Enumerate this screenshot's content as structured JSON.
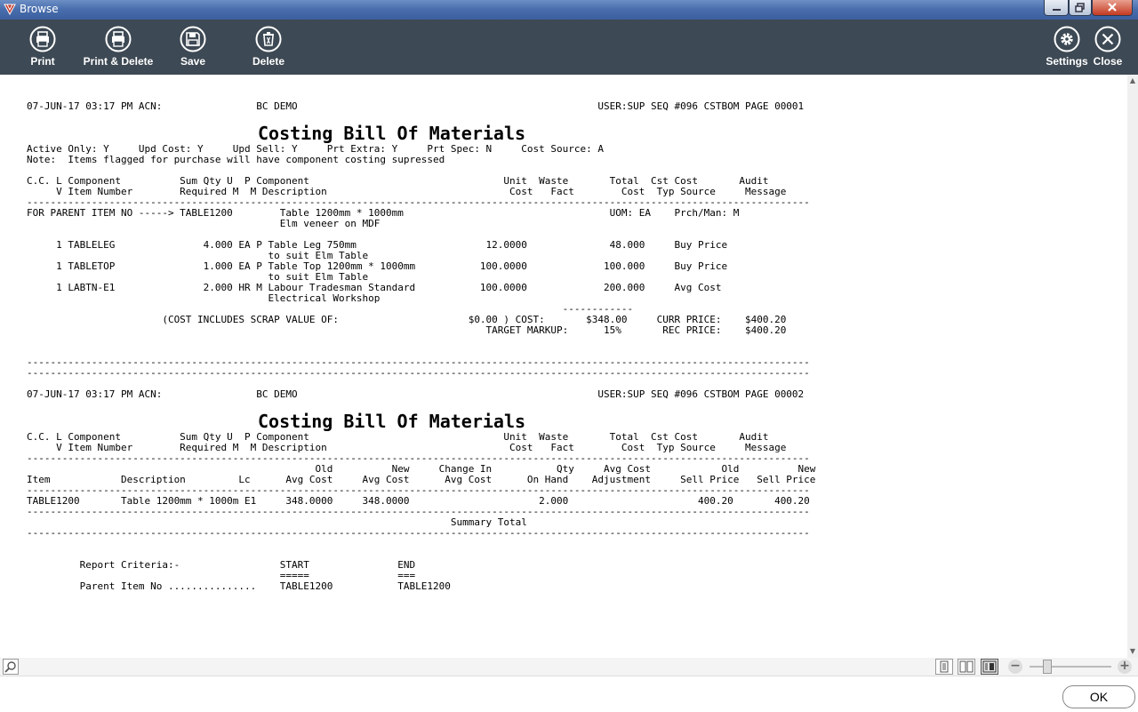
{
  "window": {
    "title": "Browse"
  },
  "toolbar": {
    "print": "Print",
    "print_delete": "Print & Delete",
    "save": "Save",
    "delete": "Delete",
    "settings": "Settings",
    "close": "Close"
  },
  "report": {
    "title": "Costing Bill Of Materials",
    "page1_header": "07-JUN-17 03:17 PM ACN:                BC DEMO                                                   USER:SUP SEQ #096 CSTBOM PAGE 00001",
    "page1_opts": "Active Only: Y     Upd Cost: Y     Upd Sell: Y     Prt Extra: Y     Prt Spec: N     Cost Source: A\nNote:  Items flagged for purchase will have component costing supressed",
    "page1_colhead": "C.C. L Component          Sum Qty U  P Component                                 Unit  Waste       Total  Cst Cost       Audit\n     V Item Number        Required M  M Description                               Cost   Fact        Cost  Typ Source     Message\n-------------------------------------------------------------------------------------------------------------------------------------",
    "page1_body": "FOR PARENT ITEM NO -----> TABLE1200        Table 1200mm * 1000mm                                   UOM: EA    Prch/Man: M\n                                           Elm veneer on MDF\n\n     1 TABLELEG               4.000 EA P Table Leg 750mm                      12.0000              48.000     Buy Price\n                                         to suit Elm Table\n     1 TABLETOP               1.000 EA P Table Top 1200mm * 1000mm           100.0000             100.000     Buy Price\n                                         to suit Elm Table\n     1 LABTN-E1               2.000 HR M Labour Tradesman Standard           100.0000             200.000     Avg Cost\n                                         Electrical Workshop\n                                                                                           ------------\n                       (COST INCLUDES SCRAP VALUE OF:                      $0.00 ) COST:       $348.00     CURR PRICE:    $400.20\n                                                                              TARGET MARKUP:      15%       REC PRICE:    $400.20\n\n\n-------------------------------------------------------------------------------------------------------------------------------------\n-------------------------------------------------------------------------------------------------------------------------------------\n",
    "page2_header": "07-JUN-17 03:17 PM ACN:                BC DEMO                                                   USER:SUP SEQ #096 CSTBOM PAGE 00002",
    "page2_colhead": "C.C. L Component          Sum Qty U  P Component                                 Unit  Waste       Total  Cst Cost       Audit\n     V Item Number        Required M  M Description                               Cost   Fact        Cost  Typ Source     Message\n-------------------------------------------------------------------------------------------------------------------------------------",
    "page2_body": "                                                 Old          New     Change In           Qty     Avg Cost            Old          New\nItem            Description         Lc      Avg Cost     Avg Cost      Avg Cost      On Hand    Adjustment     Sell Price   Sell Price\n-------------------------------------------------------------------------------------------------------------------------------------\nTABLE1200       Table 1200mm * 1000m E1     348.0000     348.0000                      2.000                      400.20       400.20\n-------------------------------------------------------------------------------------------------------------------------------------\n                                                                        Summary Total\n-------------------------------------------------------------------------------------------------------------------------------------\n\n\n         Report Criteria:-                 START               END\n                                           =====               ===\n         Parent Item No ...............    TABLE1200           TABLE1200"
  },
  "footer": {
    "ok": "OK"
  },
  "colors": {
    "toolbar": "#3d4954",
    "titlebar": "#4a6fae"
  }
}
